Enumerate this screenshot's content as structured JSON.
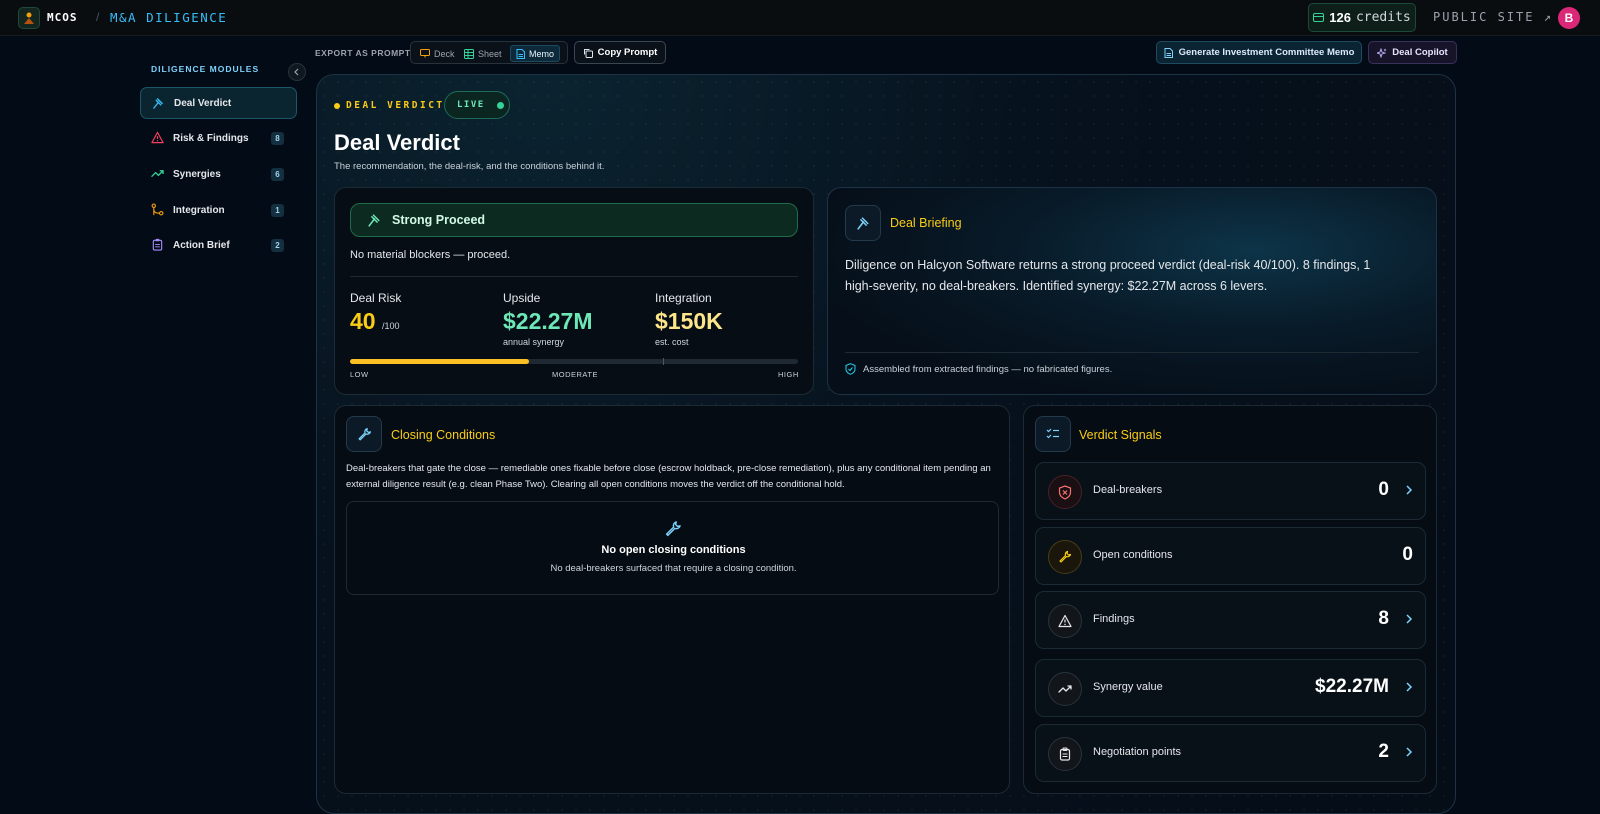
{
  "topbar": {
    "brand": "MCOS",
    "separator": "/",
    "crumb": "M&A DILIGENCE",
    "credits_value": "126",
    "credits_label": "credits",
    "public_site": "PUBLIC SITE ↗",
    "avatar_initial": "B"
  },
  "sidebar": {
    "title": "DILIGENCE MODULES",
    "items": [
      {
        "label": "Deal Verdict",
        "badge": "",
        "icon": "gavel-icon",
        "color": "#38bdf8",
        "active": true
      },
      {
        "label": "Risk & Findings",
        "badge": "8",
        "icon": "warning-triangle-icon",
        "color": "#f43f5e"
      },
      {
        "label": "Synergies",
        "badge": "6",
        "icon": "trending-up-icon",
        "color": "#34d399"
      },
      {
        "label": "Integration",
        "badge": "1",
        "icon": "git-merge-icon",
        "color": "#f59e0b"
      },
      {
        "label": "Action Brief",
        "badge": "2",
        "icon": "clipboard-icon",
        "color": "#a78bfa"
      }
    ]
  },
  "toolbar": {
    "export_label": "EXPORT AS PROMPT",
    "formats": [
      "Deck",
      "Sheet",
      "Memo"
    ],
    "active_format": "Memo",
    "copy_prompt": "Copy Prompt",
    "generate_memo": "Generate Investment Committee Memo",
    "copilot": "Deal Copilot"
  },
  "header": {
    "tag": "DEAL VERDICT",
    "live": "LIVE",
    "title": "Deal Verdict",
    "subtitle": "The recommendation, the deal-risk, and the conditions behind it."
  },
  "verdict": {
    "label": "Strong Proceed",
    "note": "No material blockers — proceed.",
    "metrics": [
      {
        "label": "Deal Risk",
        "value": "40",
        "unit": "/100",
        "sub": "",
        "color": "#facc15"
      },
      {
        "label": "Upside",
        "value": "$22.27M",
        "unit": "",
        "sub": "annual synergy",
        "color": "#6ee7b7"
      },
      {
        "label": "Integration",
        "value": "$150K",
        "unit": "",
        "sub": "est. cost",
        "color": "#fde68a"
      }
    ],
    "risk_level": 0.4,
    "scale": [
      "LOW",
      "MODERATE",
      "HIGH"
    ]
  },
  "briefing": {
    "title": "Deal Briefing",
    "text": "Diligence on Halcyon Software returns a strong proceed verdict (deal-risk 40/100). 8 findings, 1 high-severity, no deal-breakers. Identified synergy: $22.27M across 6 levers.",
    "note": "Assembled from extracted findings — no fabricated figures."
  },
  "closing": {
    "title": "Closing Conditions",
    "text": "Deal-breakers that gate the close — remediable ones fixable before close (escrow holdback, pre-close remediation), plus any conditional item pending an external diligence result (e.g. clean Phase Two). Clearing all open conditions moves the verdict off the conditional hold.",
    "empty_title": "No open closing conditions",
    "empty_desc": "No deal-breakers surfaced that require a closing condition."
  },
  "signals": {
    "title": "Verdict Signals",
    "rows": [
      {
        "label": "Deal-breakers",
        "value": "0",
        "icon": "shield-x-icon",
        "color": "#f87171",
        "chevron": true
      },
      {
        "label": "Open conditions",
        "value": "0",
        "icon": "wrench-icon",
        "color": "#facc15",
        "chevron": false
      },
      {
        "label": "Findings",
        "value": "8",
        "icon": "warning-triangle-icon",
        "color": "#e5e7eb",
        "chevron": true
      },
      {
        "label": "Synergy value",
        "value": "$22.27M",
        "icon": "trending-up-icon",
        "color": "#e5e7eb",
        "chevron": true
      },
      {
        "label": "Negotiation points",
        "value": "2",
        "icon": "clipboard-icon",
        "color": "#e5e7eb",
        "chevron": true
      }
    ]
  }
}
